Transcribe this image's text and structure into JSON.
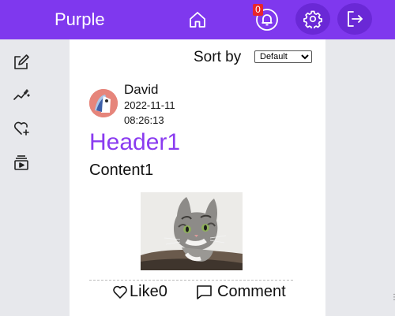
{
  "app": {
    "brand": "Purple"
  },
  "header": {
    "notification_count": "0",
    "icons": [
      "home-icon",
      "bell-icon",
      "gear-icon",
      "logout-icon"
    ]
  },
  "sidebar": {
    "items": [
      {
        "icon": "edit-icon"
      },
      {
        "icon": "sparkline-icon"
      },
      {
        "icon": "heart-plus-icon"
      },
      {
        "icon": "playlist-icon"
      }
    ]
  },
  "feed": {
    "sort_label": "Sort by",
    "sort_selected": "Default"
  },
  "post": {
    "author": "David",
    "date": "2022-11-11",
    "time": "08:26:13",
    "title": "Header1",
    "content": "Content1",
    "like_label": "Like",
    "like_count": "0",
    "comment_label": "Comment"
  },
  "colors": {
    "brand": "#7f38ee",
    "brand_dark": "#6a28d6",
    "title": "#8a3bf0",
    "badge": "#e8262b"
  }
}
